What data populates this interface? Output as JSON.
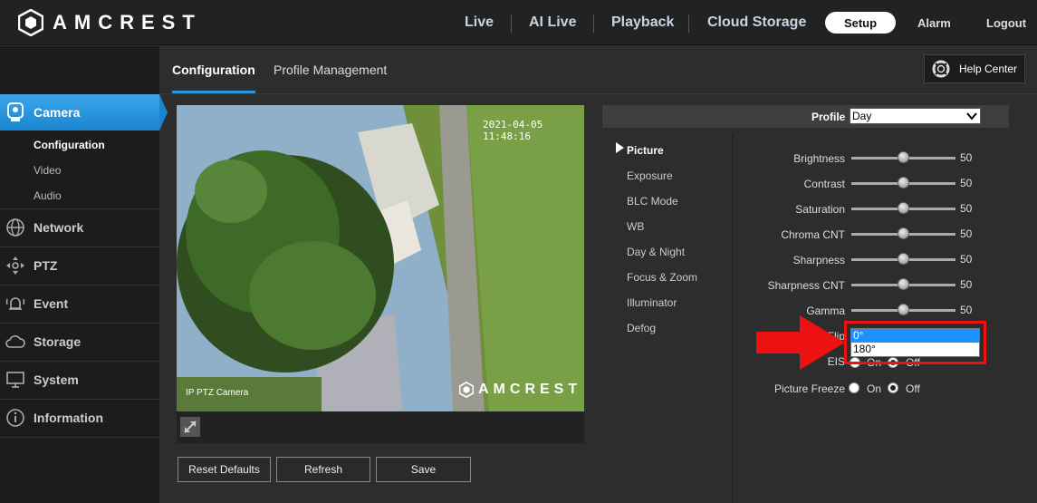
{
  "brand": "AMCREST",
  "nav": {
    "items": [
      "Live",
      "AI Live",
      "Playback",
      "Cloud Storage"
    ],
    "setup": "Setup",
    "alarm": "Alarm",
    "logout": "Logout"
  },
  "sidebar": {
    "camera": "Camera",
    "sub_items": [
      "Configuration",
      "Video",
      "Audio"
    ],
    "items": [
      "Network",
      "PTZ",
      "Event",
      "Storage",
      "System",
      "Information"
    ]
  },
  "tabs": [
    "Configuration",
    "Profile Management"
  ],
  "help": "Help Center",
  "video": {
    "timestamp": "2021-04-05 11:48:16",
    "channel": "IP PTZ Camera",
    "watermark": "AMCREST"
  },
  "buttons": {
    "reset": "Reset Defaults",
    "refresh": "Refresh",
    "save": "Save"
  },
  "profile": {
    "label": "Profile",
    "value": "Day"
  },
  "submenu": [
    "Picture",
    "Exposure",
    "BLC Mode",
    "WB",
    "Day & Night",
    "Focus & Zoom",
    "Illuminator",
    "Defog"
  ],
  "sliders": [
    {
      "label": "Brightness",
      "value": 50
    },
    {
      "label": "Contrast",
      "value": 50
    },
    {
      "label": "Saturation",
      "value": 50
    },
    {
      "label": "Chroma CNT",
      "value": 50
    },
    {
      "label": "Sharpness",
      "value": 50
    },
    {
      "label": "Sharpness CNT",
      "value": 50
    },
    {
      "label": "Gamma",
      "value": 50
    }
  ],
  "flip": {
    "label": "Flip",
    "options": [
      "0°",
      "180°"
    ]
  },
  "eis": {
    "label": "EIS",
    "on": "On",
    "off": "Off"
  },
  "freeze": {
    "label": "Picture Freeze",
    "on": "On",
    "off": "Off"
  },
  "colors": {
    "accent": "#2b95e0",
    "highlight": "#e11111"
  }
}
